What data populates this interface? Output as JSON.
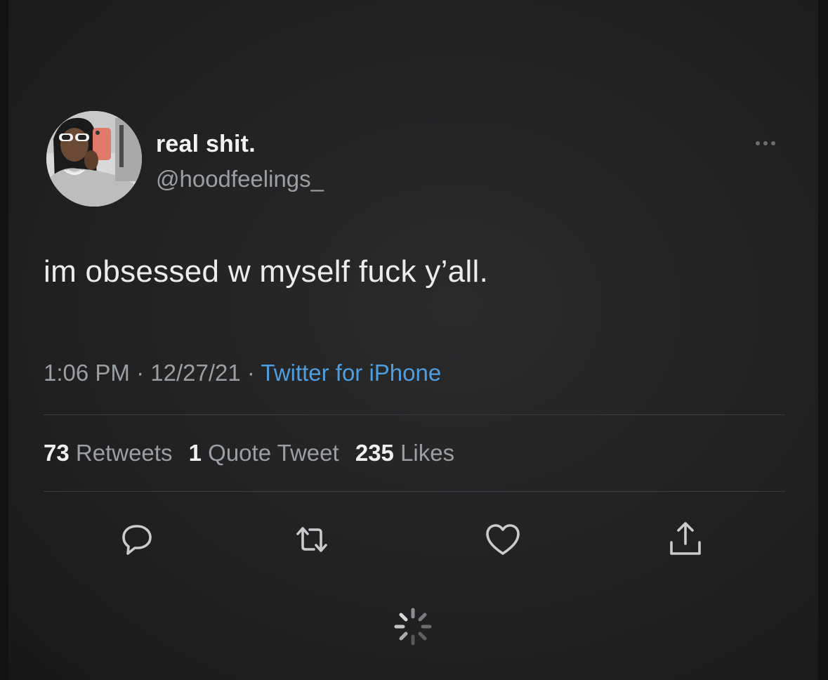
{
  "tweet": {
    "display_name": "real shit.",
    "handle": "@hoodfeelings_",
    "text": "im obsessed w myself fuck y’all.",
    "time": "1:06 PM",
    "date": "12/27/21",
    "separator": " · ",
    "source": "Twitter for iPhone"
  },
  "stats": {
    "retweets_count": "73",
    "retweets_label": "Retweets",
    "quotes_count": "1",
    "quotes_label": "Quote Tweet",
    "likes_count": "235",
    "likes_label": "Likes"
  },
  "actions": [
    "reply-icon",
    "retweet-icon",
    "heart-icon",
    "share-icon"
  ],
  "colors": {
    "background": "#232324",
    "text": "#e7e9ea",
    "secondary": "#9a9fa3",
    "link": "#4f9ee0"
  }
}
